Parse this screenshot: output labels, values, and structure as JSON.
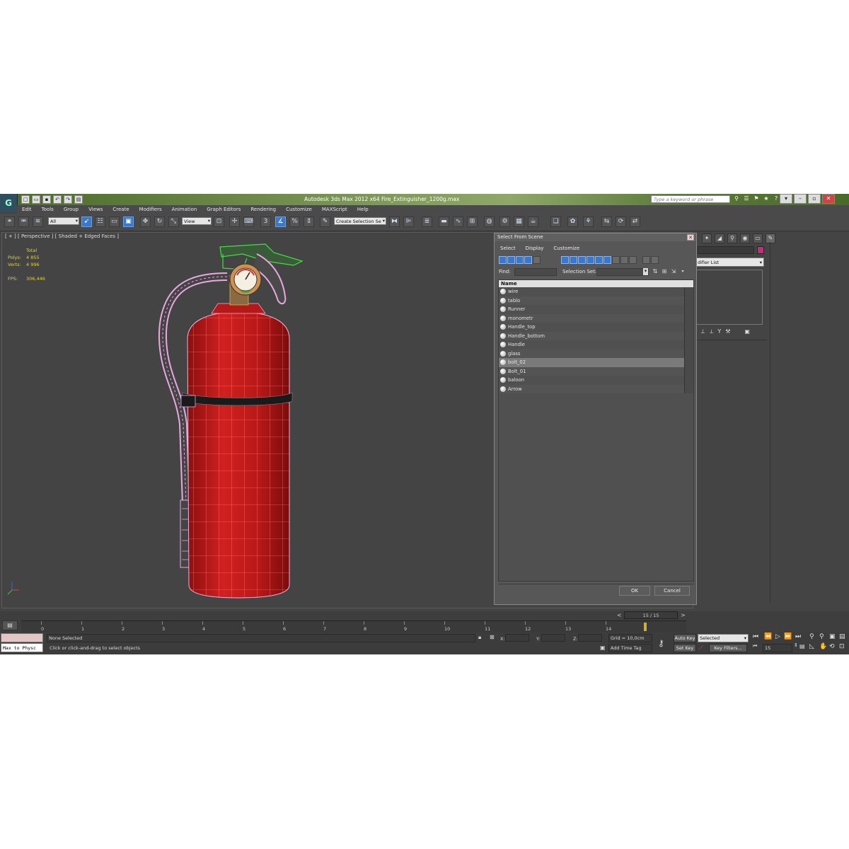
{
  "window": {
    "title": "Autodesk 3ds Max  2012 x64      Fire_Extinguisher_1200g.max",
    "search_placeholder": "Type a keyword or phrase"
  },
  "menu": [
    "Edit",
    "Tools",
    "Group",
    "Views",
    "Create",
    "Modifiers",
    "Animation",
    "Graph Editors",
    "Rendering",
    "Customize",
    "MAXScript",
    "Help"
  ],
  "toolbar": {
    "filter_value": "All",
    "refcoord_value": "View",
    "selection_set_value": "Create Selection Se"
  },
  "viewport": {
    "label": "[ + ] [ Perspective ] [ Shaded + Edged Faces ]",
    "stats": {
      "header": "Total",
      "polys_label": "Polys:",
      "polys_value": "4 855",
      "verts_label": "Verts:",
      "verts_value": "4 996",
      "fps_label": "FPS:",
      "fps_value": "306,446"
    }
  },
  "command_panel": {
    "modifier_list": "difier List"
  },
  "dialog": {
    "title": "Select From Scene",
    "menu": [
      "Select",
      "Display",
      "Customize"
    ],
    "find_label": "Find:",
    "selection_set_label": "Selection Set:",
    "column_header": "Name",
    "objects": [
      "wire",
      "tablo",
      "Runner",
      "monometr",
      "Handle_top",
      "Handle_bottom",
      "Handle",
      "glass",
      "bolt_02",
      "Bolt_01",
      "baloon",
      "Arrow"
    ],
    "selected_object": "bolt_02",
    "ok_label": "OK",
    "cancel_label": "Cancel"
  },
  "timeline": {
    "frame_display": "15 / 15",
    "ticks": [
      "0",
      "1",
      "2",
      "3",
      "4",
      "5",
      "6",
      "7",
      "8",
      "9",
      "10",
      "11",
      "12",
      "13",
      "14"
    ]
  },
  "status": {
    "script_listener": "Max to Physc",
    "selection_status": "None Selected",
    "prompt": "Click or click-and-drag to select objects",
    "x_label": "X:",
    "y_label": "Y:",
    "z_label": "Z:",
    "grid": "Grid = 10,0cm",
    "add_time_tag": "Add Time Tag",
    "auto_key": "Auto Key",
    "set_key": "Set Key",
    "key_mode_value": "Selected",
    "key_filters": "Key Filters...",
    "current_frame": "15"
  },
  "colors": {
    "extinguisher_body": "#c01818",
    "wire_pink": "#f0a0e0",
    "wire_green": "#40e040",
    "selection_blue": "#3c78c8",
    "stats_yellow": "#e4d23a"
  }
}
